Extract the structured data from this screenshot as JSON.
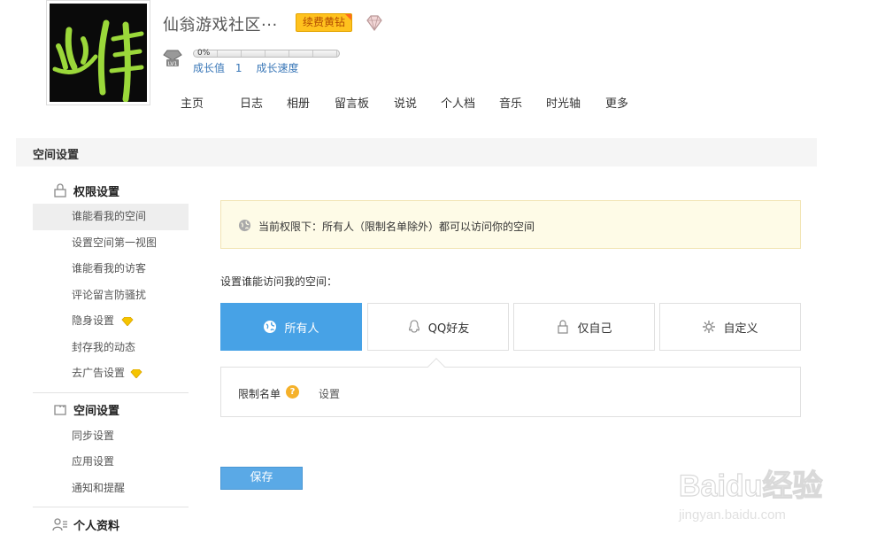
{
  "header": {
    "space_name": "仙翁游戏社区···",
    "renew_badge": "续费黄钻",
    "growth": {
      "percent_label": "0%",
      "value_label": "成长值",
      "value": "1",
      "speed_label": "成长速度"
    },
    "nav": [
      "主页",
      "日志",
      "相册",
      "留言板",
      "说说",
      "个人档",
      "音乐",
      "时光轴",
      "更多"
    ]
  },
  "section_title": "空间设置",
  "sidebar": {
    "groups": [
      {
        "title": "权限设置",
        "icon": "lock-icon",
        "items": [
          {
            "label": "谁能看我的空间",
            "active": true
          },
          {
            "label": "设置空间第一视图"
          },
          {
            "label": "谁能看我的访客"
          },
          {
            "label": "评论留言防骚扰"
          },
          {
            "label": "隐身设置",
            "diamond": true
          },
          {
            "label": "封存我的动态"
          },
          {
            "label": "去广告设置",
            "diamond": true
          }
        ]
      },
      {
        "title": "空间设置",
        "icon": "puzzle-icon",
        "items": [
          {
            "label": "同步设置"
          },
          {
            "label": "应用设置"
          },
          {
            "label": "通知和提醒"
          }
        ]
      },
      {
        "title": "个人资料",
        "icon": "profile-icon",
        "items": []
      }
    ]
  },
  "notice": {
    "text": "当前权限下：所有人（限制名单除外）都可以访问你的空间"
  },
  "access": {
    "label": "设置谁能访问我的空间：",
    "options": [
      {
        "label": "所有人",
        "icon": "globe-icon",
        "selected": true
      },
      {
        "label": "QQ好友",
        "icon": "qq-icon"
      },
      {
        "label": "仅自己",
        "icon": "lock-icon"
      },
      {
        "label": "自定义",
        "icon": "gear-icon"
      }
    ],
    "limit_label": "限制名单",
    "limit_help": "?",
    "limit_set": "设置"
  },
  "save_label": "保存",
  "watermark": {
    "brand": "Baidu经验",
    "url": "jingyan.baidu.com"
  },
  "colors": {
    "accent": "#47a2e6",
    "badge": "#ffc21e",
    "notice_bg": "#fefbe7",
    "diamond": "#f5c400"
  }
}
